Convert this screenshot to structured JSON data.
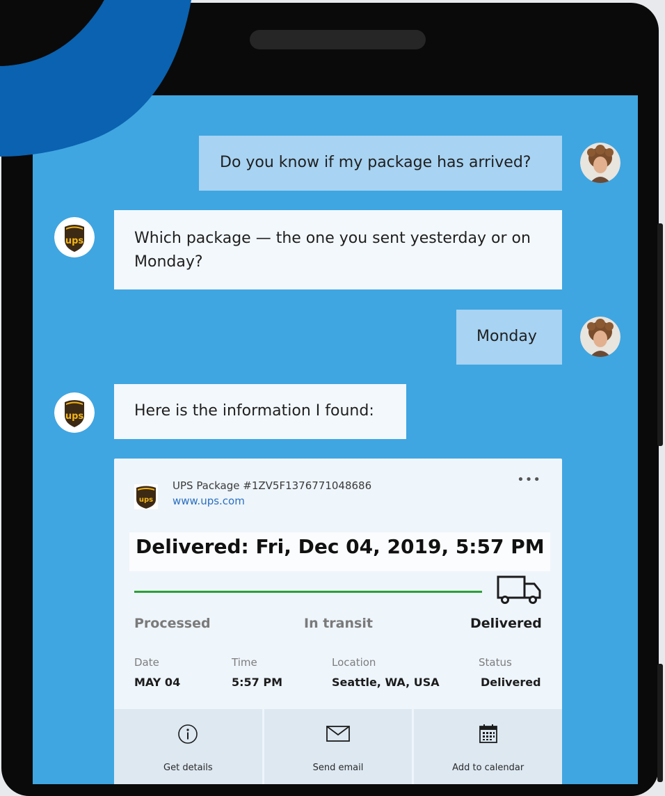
{
  "chat": {
    "messages": [
      {
        "sender": "user",
        "text": "Do you know if my package has arrived?"
      },
      {
        "sender": "bot",
        "text": "Which package — the one you sent yesterday or on Monday?"
      },
      {
        "sender": "user",
        "text": "Monday"
      },
      {
        "sender": "bot",
        "text": "Here is the information I found:"
      }
    ]
  },
  "card": {
    "title": "UPS Package #1ZV5F1376771048686",
    "link": "www.ups.com",
    "more_label": "•••",
    "headline": "Delivered: Fri, Dec 04, 2019, 5:57 PM",
    "steps": [
      "Processed",
      "In transit",
      "Delivered"
    ],
    "current_step": "Delivered",
    "details": {
      "labels": [
        "Date",
        "Time",
        "Location",
        "Status"
      ],
      "values": [
        "MAY 04",
        "5:57 PM",
        "Seattle, WA, USA",
        "Delivered"
      ]
    },
    "actions": [
      {
        "label": "Get details",
        "icon": "info-icon"
      },
      {
        "label": "Send email",
        "icon": "mail-icon"
      },
      {
        "label": "Add to calendar",
        "icon": "calendar-icon"
      }
    ]
  },
  "brand": {
    "ups_logo_text": "ups",
    "colors": {
      "screen_bg": "#3fa6e1",
      "accent_arc": "#0a60ad",
      "user_bubble": "#a8d3f2",
      "bot_bubble": "#f3f8fc",
      "progress": "#2aa133",
      "ups_brown": "#3d2a14",
      "ups_gold": "#f2b51b"
    }
  }
}
